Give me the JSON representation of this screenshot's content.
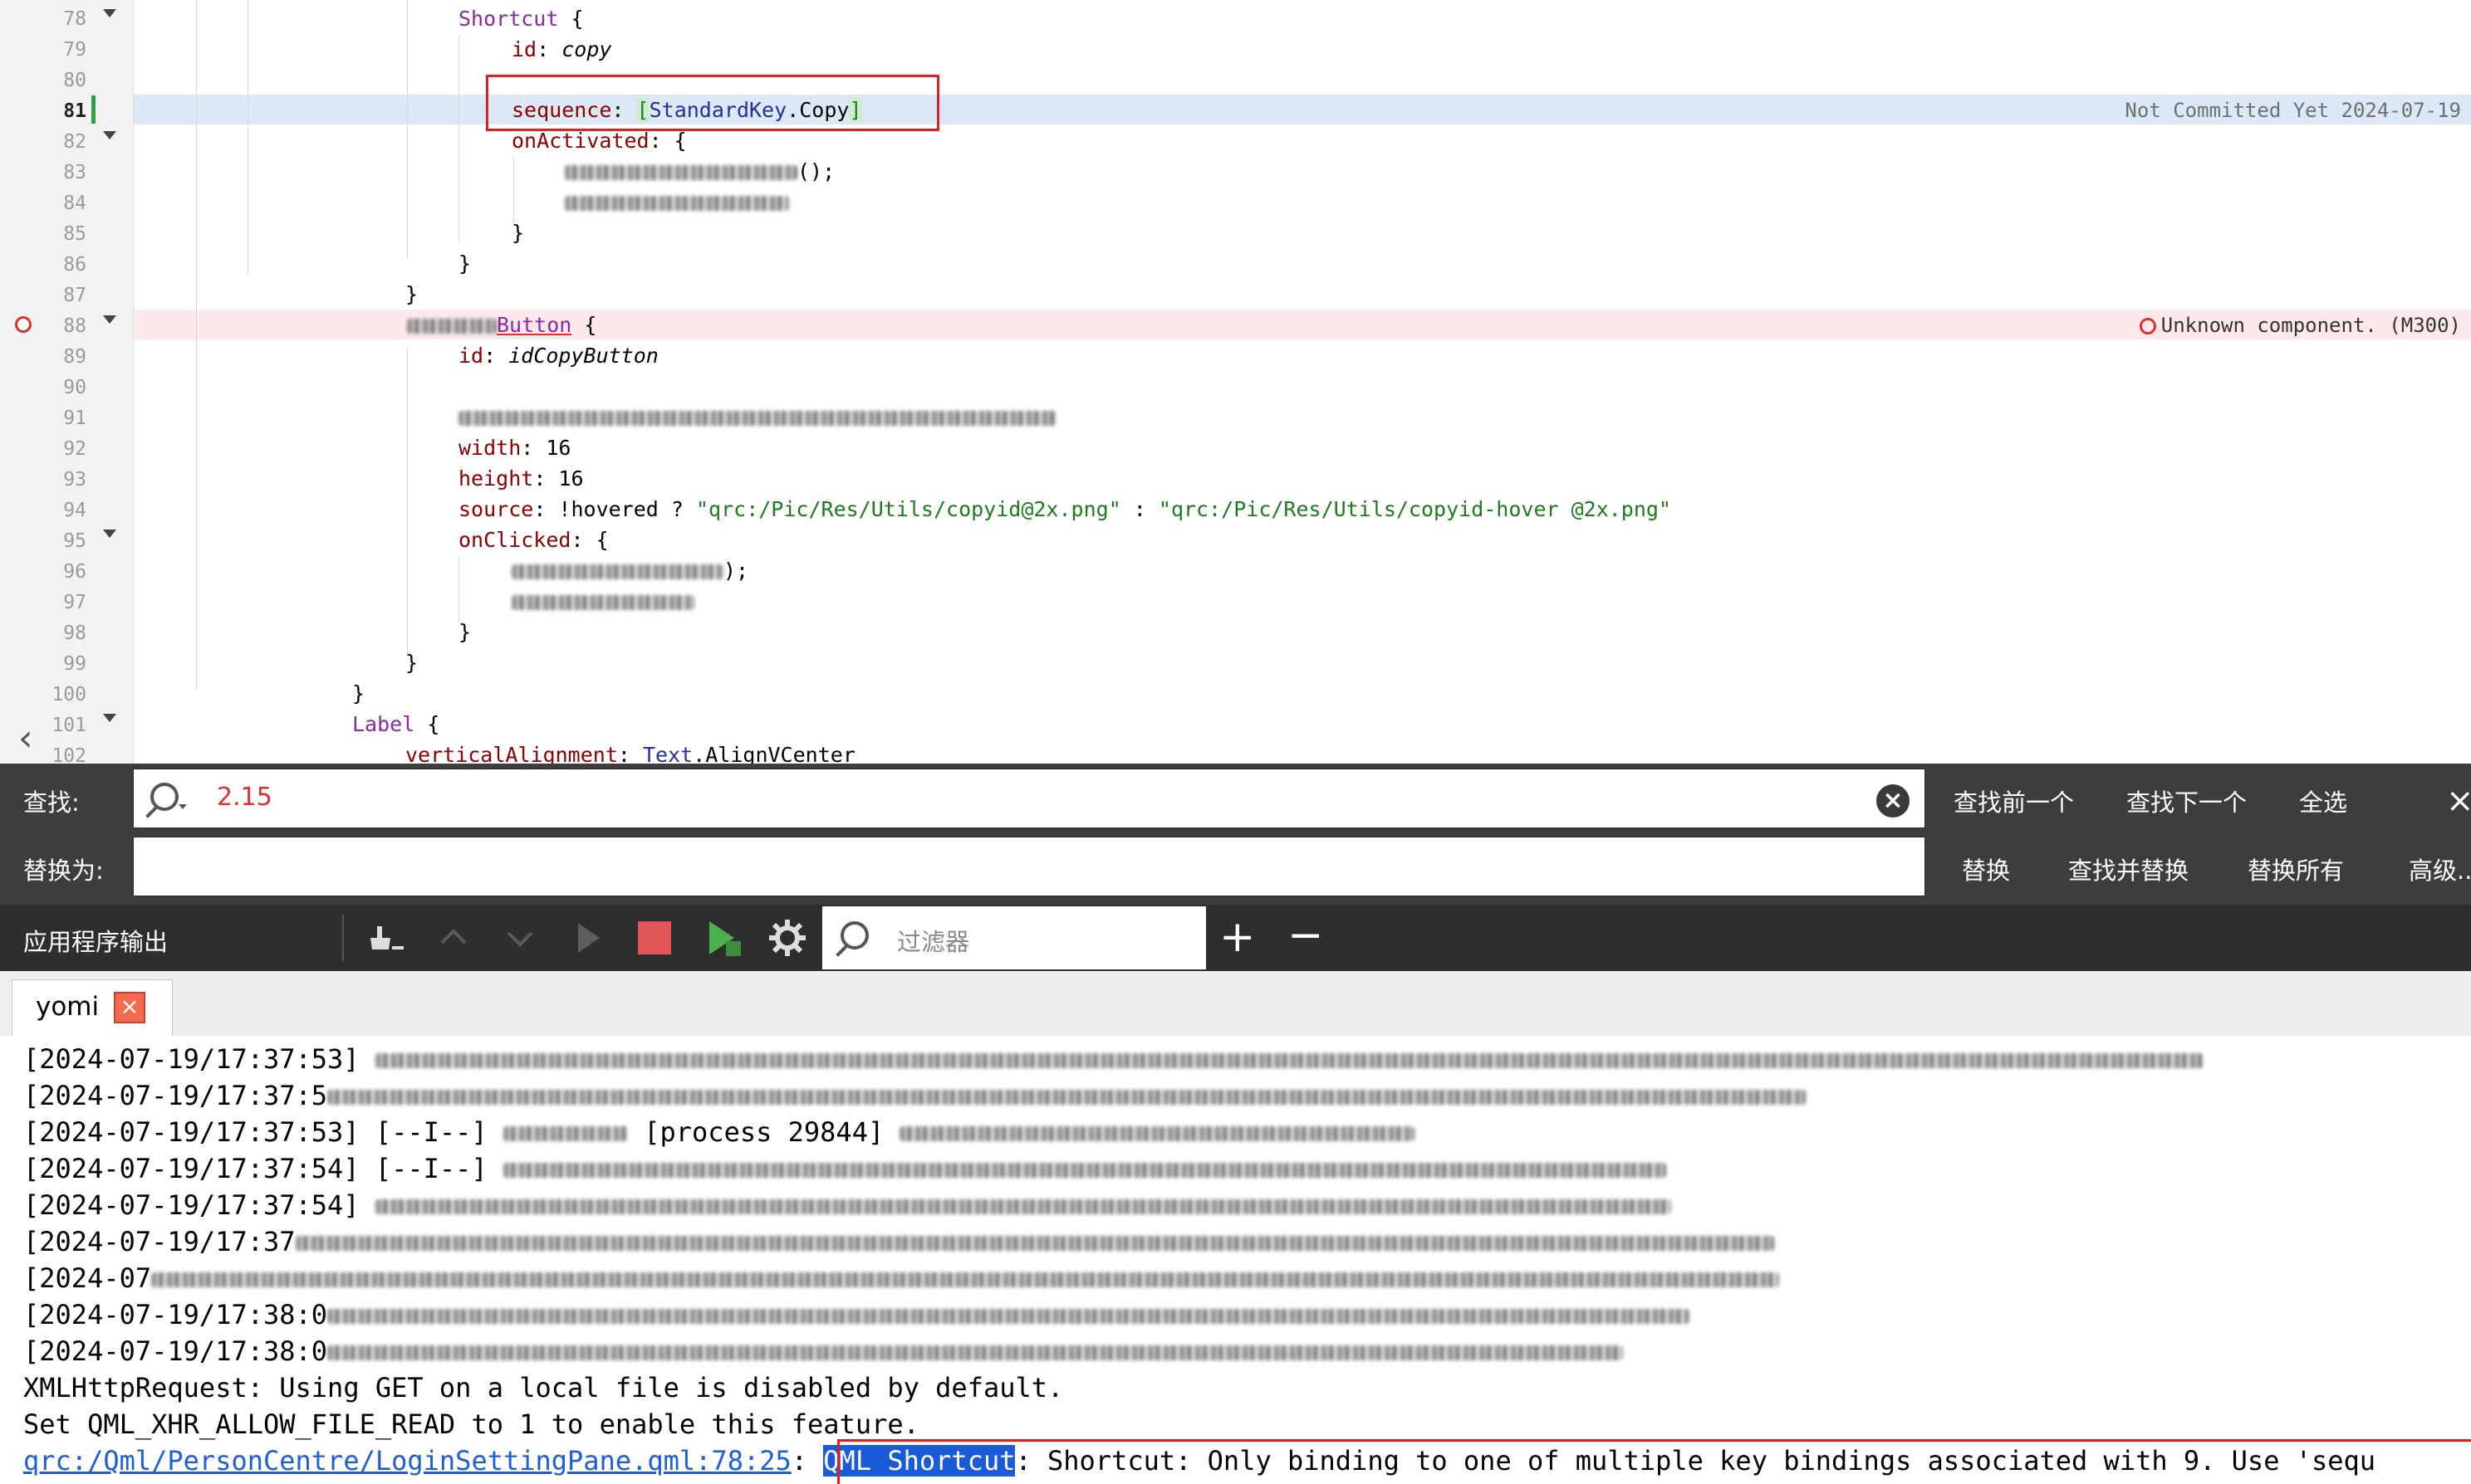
{
  "editor": {
    "line_numbers": [
      "78",
      "79",
      "80",
      "81",
      "82",
      "83",
      "84",
      "85",
      "86",
      "87",
      "88",
      "89",
      "90",
      "91",
      "92",
      "93",
      "94",
      "95",
      "96",
      "97",
      "98",
      "99",
      "100",
      "101",
      "102"
    ],
    "lines": {
      "l78_type": "Shortcut",
      "l78_brace": " {",
      "l79_key": "id",
      "l79_val": "copy",
      "l81_key": "sequence",
      "l81_type": "StandardKey",
      "l81_val": ".Copy",
      "l82_key": "onActivated",
      "l82_brace": ": {",
      "l83_tail": "();",
      "l85_brace": "}",
      "l86_brace": "}",
      "l87_brace": "}",
      "l88_type": "Button",
      "l88_brace": " {",
      "l89_key": "id",
      "l89_val": "idCopyButton",
      "l92_key": "width",
      "l92_val": "16",
      "l93_key": "height",
      "l93_val": "16",
      "l94_key": "source",
      "l94_expr": "!hovered ? ",
      "l94_str1": "\"qrc:/Pic/Res/Utils/copyid@2x.png\"",
      "l94_mid": " : ",
      "l94_str2": "\"qrc:/Pic/Res/Utils/copyid-hover @2x.png\"",
      "l95_key": "onClicked",
      "l95_brace": ": {",
      "l96_tail": ");",
      "l98_brace": "}",
      "l99_brace": "}",
      "l100_brace": "}",
      "l101_type": "Label",
      "l101_brace": " {",
      "l102_key": "verticalAlignment",
      "l102_type": "Text",
      "l102_val": ".AlignVCenter"
    },
    "annotations": {
      "blame": "Not Committed Yet 2024-07-19",
      "error": "Unknown component. (M300)"
    }
  },
  "findbar": {
    "find_label": "查找:",
    "find_value": "2.15",
    "replace_label": "替换为:",
    "replace_value": "",
    "find_prev": "查找前一个",
    "find_next": "查找下一个",
    "select_all": "全选",
    "replace": "替换",
    "find_replace": "查找并替换",
    "replace_all": "替换所有",
    "advanced": "高级..."
  },
  "output_panel": {
    "title": "应用程序输出",
    "filter_placeholder": "过滤器",
    "tab_label": "yomi",
    "lines": [
      {
        "ts": "[2024-07-19/17:37:53]",
        "rest": ""
      },
      {
        "ts": "[2024-07-19/17:37:5",
        "rest": ""
      },
      {
        "ts": "[2024-07-19/17:37:53]",
        "level": "[--I--]",
        "rest": "[process 29844]"
      },
      {
        "ts": "[2024-07-19/17:37:54]",
        "level": "[--I--]",
        "rest": ""
      },
      {
        "ts": "[2024-07-19/17:37:54]",
        "rest": ""
      },
      {
        "ts": "[2024-07-19/17:37",
        "rest": ""
      },
      {
        "ts": "[2024-07",
        "rest": ""
      },
      {
        "ts": "[2024-07-19/17:38:0",
        "rest": ""
      },
      {
        "ts": "[2024-07-19/17:38:0",
        "rest": ""
      }
    ],
    "xhr_line": "XMLHttpRequest: Using GET on a local file is disabled by default.",
    "set_line": "Set QML_XHR_ALLOW_FILE_READ to 1 to enable this feature.",
    "warning": {
      "link": "qrc:/Qml/PersonCentre/LoginSettingPane.qml:78:25",
      "sep": ": ",
      "selected": "QML Shortcut",
      "message": ": Shortcut: Only binding to one of multiple key bindings associated with 9. Use 'sequ"
    }
  },
  "colors": {
    "accent_red": "#e02020",
    "link_blue": "#1e5fd6",
    "selection_blue": "#1a5bd8",
    "dark_panel": "#3d3d3d"
  }
}
